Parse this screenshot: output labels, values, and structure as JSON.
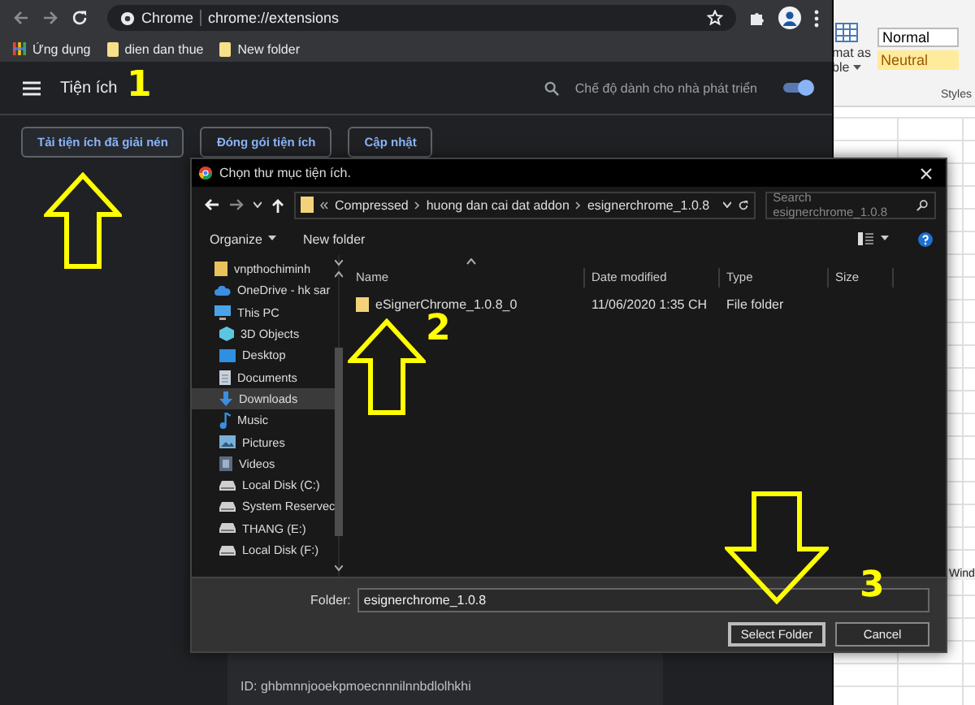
{
  "chrome": {
    "site": "Chrome",
    "url": "chrome://extensions",
    "bookmarks": [
      {
        "kind": "apps",
        "label": "Ứng dụng"
      },
      {
        "kind": "folder",
        "label": "dien dan thue"
      },
      {
        "kind": "folder",
        "label": "New folder"
      }
    ],
    "title": "Tiện ích",
    "dev_mode": {
      "label": "Chế độ dành cho nhà phát triển",
      "on": true
    },
    "actions": [
      "Tải tiện ích đã giải nén",
      "Đóng gói tiện ích",
      "Cập nhật"
    ],
    "extension_id": "ID: ghbmnnjooekpmoecnnnilnnbdlolhkhi"
  },
  "excel": {
    "format_label": "mat as",
    "format_sublabel": "ble",
    "styles": [
      {
        "kind": "normal",
        "label": "Normal"
      },
      {
        "kind": "neutral",
        "label": "Neutral"
      }
    ],
    "group_label": "Styles",
    "tab": "Wind"
  },
  "dialog": {
    "title": "Chọn thư mục tiện ích.",
    "path": [
      "Compressed",
      "huong dan cai dat addon",
      "esignerchrome_1.0.8"
    ],
    "search": {
      "placeholder": "Search esignerchrome_1.0.8"
    },
    "toolbar": [
      "Organize",
      "New folder"
    ],
    "nav": [
      {
        "kind": "folder",
        "label": "vnpthochiminh",
        "selected": false
      },
      {
        "kind": "cloud",
        "label": "OneDrive - hk sar",
        "selected": false
      },
      {
        "kind": "computer",
        "label": "This PC",
        "selected": false,
        "children": [
          {
            "kind": "objects",
            "label": "3D Objects",
            "selected": false
          },
          {
            "kind": "desktop",
            "label": "Desktop",
            "selected": false
          },
          {
            "kind": "documents",
            "label": "Documents",
            "selected": false
          },
          {
            "kind": "downloads",
            "label": "Downloads",
            "selected": true
          },
          {
            "kind": "music",
            "label": "Music",
            "selected": false
          },
          {
            "kind": "pictures",
            "label": "Pictures",
            "selected": false
          },
          {
            "kind": "videos",
            "label": "Videos",
            "selected": false
          },
          {
            "kind": "drive",
            "label": "Local Disk (C:)",
            "selected": false
          },
          {
            "kind": "drive",
            "label": "System Reservec",
            "selected": false
          },
          {
            "kind": "drive",
            "label": "THANG (E:)",
            "selected": false
          },
          {
            "kind": "drive",
            "label": "Local Disk (F:)",
            "selected": false
          }
        ]
      }
    ],
    "columns": [
      "Name",
      "Date modified",
      "Type",
      "Size"
    ],
    "rows": [
      {
        "name": "eSignerChrome_1.0.8_0",
        "date": "11/06/2020 1:35 CH",
        "type": "File folder"
      }
    ],
    "folder_label": "Folder:",
    "folder_value": "esignerchrome_1.0.8",
    "buttons": [
      "Select Folder",
      "Cancel"
    ]
  },
  "annotations": [
    {
      "kind": "step",
      "text": "1"
    },
    {
      "kind": "arrow_up"
    },
    {
      "kind": "step",
      "text": "2"
    },
    {
      "kind": "arrow_up"
    },
    {
      "kind": "arrow_down"
    },
    {
      "kind": "step",
      "text": "3"
    }
  ]
}
